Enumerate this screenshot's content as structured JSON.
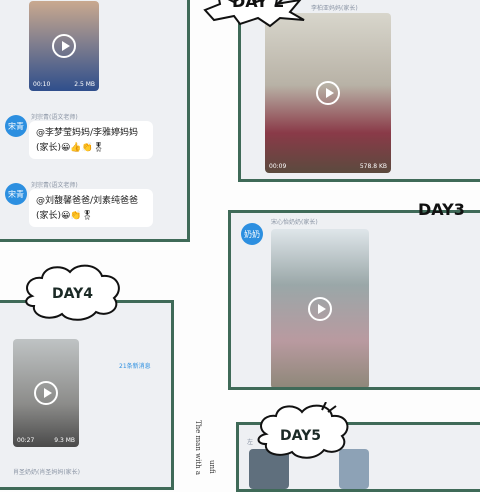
{
  "top_left": {
    "video": {
      "duration": "00:10",
      "size": "2.5 MB"
    },
    "messages": [
      {
        "avatar": "宋青",
        "sender": "刘宗青(语文老师)",
        "text_line1": "@李梦莹妈妈/李雅婷妈妈",
        "text_line2": "(家长)😀👍👏🎖"
      },
      {
        "avatar": "宋青",
        "sender": "刘宗青(语文老师)",
        "text_line1": "@刘馥馨爸爸/刘素纯爸爸",
        "text_line2": "(家长)😀👏🎖"
      }
    ]
  },
  "day2": {
    "label": "DAY 2",
    "sender": "李柏亚妈妈(家长)",
    "video": {
      "duration": "00:09",
      "size": "578.8 KB"
    }
  },
  "day3": {
    "label": "DAY3",
    "avatar": "奶奶",
    "sender": "宋心怡奶奶(家长)"
  },
  "day4": {
    "label": "DAY4",
    "new_count": "21条新消息",
    "video": {
      "duration": "00:27",
      "size": "9.3 MB"
    },
    "sender_bottom": "肖圣奶奶(肖圣妈妈(家长)"
  },
  "day5": {
    "label": "DAY5",
    "sender_partial": "左",
    "side_text": "The man with a",
    "side_text2": "unfi"
  },
  "colors": {
    "frame": "#3f6a58",
    "avatar": "#2c8fe0"
  }
}
